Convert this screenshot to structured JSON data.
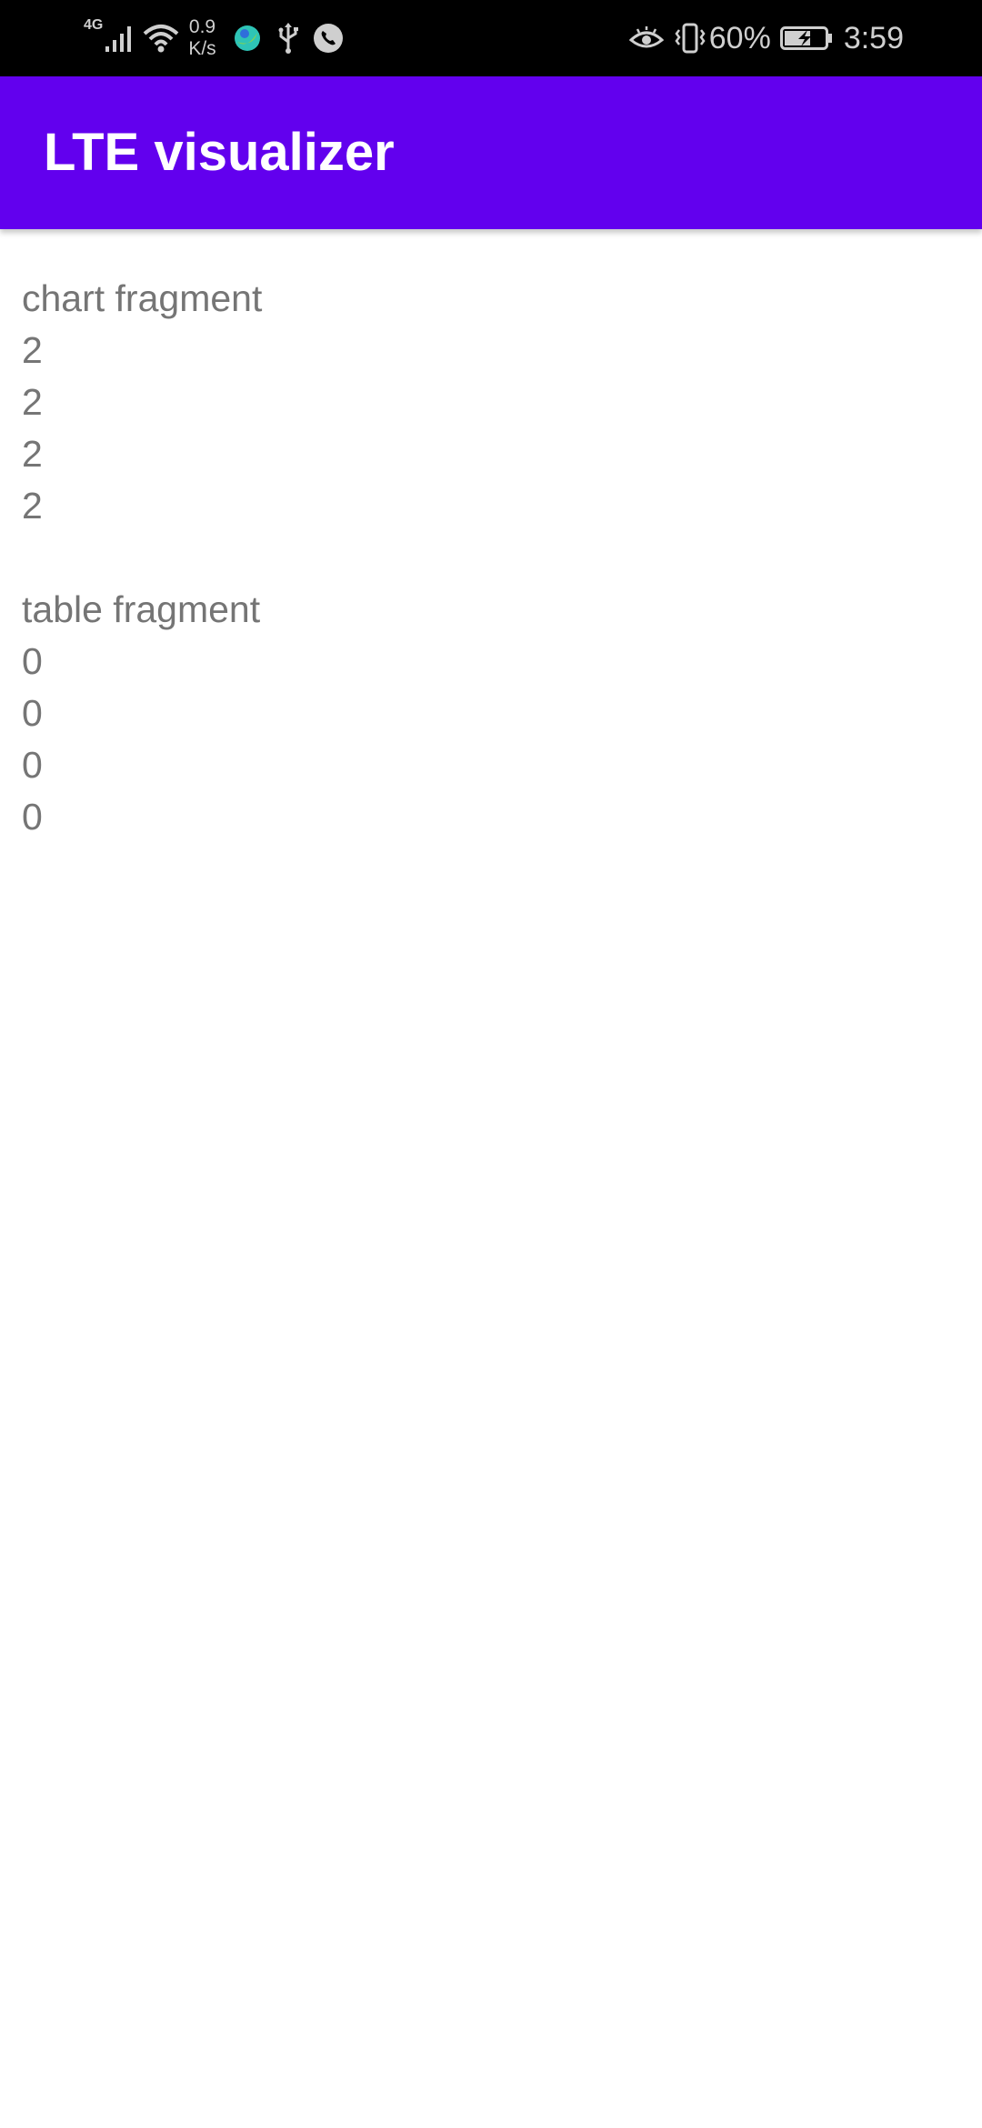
{
  "status_bar": {
    "network_type": "4G",
    "speed_value": "0.9",
    "speed_unit": "K/s",
    "battery": "60%",
    "time": "3:59",
    "icons_left": [
      "signal-icon",
      "wifi-icon",
      "browser-icon",
      "usb-icon",
      "phone-icon"
    ],
    "icons_right": [
      "eye-icon",
      "vibrate-icon",
      "battery-charging-icon"
    ]
  },
  "app_bar": {
    "title": "LTE visualizer",
    "color": "#6200ee"
  },
  "chart_fragment": {
    "title": "chart fragment",
    "values": [
      "2",
      "2",
      "2",
      "2"
    ]
  },
  "table_fragment": {
    "title": "table fragment",
    "values": [
      "0",
      "0",
      "0",
      "0"
    ]
  },
  "colors": {
    "text": "#757575",
    "status_bar": "#000000"
  }
}
